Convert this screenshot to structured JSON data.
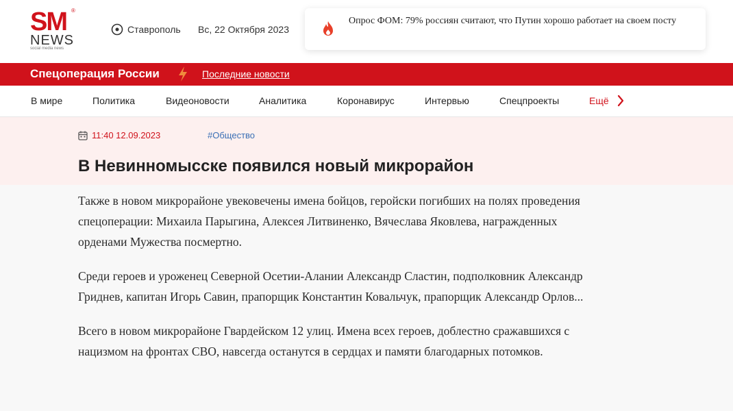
{
  "header": {
    "logo": {
      "mark": "SM",
      "registered": "®",
      "word": "NEWS",
      "tagline": "social media news"
    },
    "location": "Ставрополь",
    "date": "Вс, 22 Октября 2023",
    "poll": {
      "icon": "fire-icon",
      "text": "Опрос ФОМ: 79% россиян считают, что Путин хорошо работает на своем посту"
    }
  },
  "red_bar": {
    "title": "Спецоперация России",
    "icon": "lightning-icon",
    "link": "Последние новости"
  },
  "nav": {
    "items": [
      "В мире",
      "Политика",
      "Видеоновости",
      "Аналитика",
      "Коронавирус",
      "Интервью",
      "Спецпроекты"
    ],
    "more": "Ещё"
  },
  "article": {
    "time": "11:40 12.09.2023",
    "tag": "#Общество",
    "title": "В Невинномысске появился новый микрорайон",
    "paragraphs": [
      "Также в новом микрорайоне увековечены имена бойцов, геройски погибших на полях проведения спецоперации: Михаила Парыгина, Алексея Литвиненко, Вячеслава Яковлева, награжденных орденами Мужества посмертно.",
      "Среди героев и уроженец Северной Осетии-Алании Александр Сластин, подполковник Александр Гриднев, капитан Игорь Савин, прапорщик Константин Ковальчук, прапорщик Александр Орлов...",
      "Всего в новом микрорайоне Гвардейском 12 улиц. Имена всех героев, доблестно сражавшихся с нацизмом на фронтах СВО, навсегда останутся в сердцах и памяти благодарных потомков."
    ]
  },
  "colors": {
    "brand_red": "#d0121b",
    "tag_blue": "#3a6fb5",
    "band_pink": "#fdf0ef"
  }
}
